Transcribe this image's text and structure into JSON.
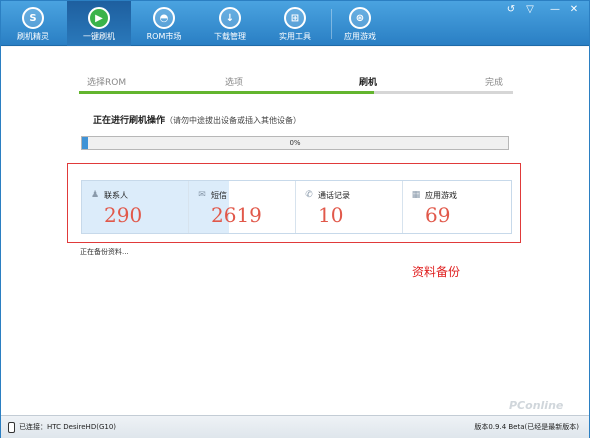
{
  "toolbar": {
    "items": [
      {
        "label": "刷机精灵",
        "icon": "s-logo-icon",
        "glyph": "S"
      },
      {
        "label": "一键刷机",
        "icon": "play-icon",
        "glyph": "▶"
      },
      {
        "label": "ROM市场",
        "icon": "android-icon",
        "glyph": "◓"
      },
      {
        "label": "下载管理",
        "icon": "download-icon",
        "glyph": "↓"
      },
      {
        "label": "实用工具",
        "icon": "tools-grid-icon",
        "glyph": "⊞"
      },
      {
        "label": "应用游戏",
        "icon": "basketball-icon",
        "glyph": "⊛"
      }
    ],
    "active_index": 1,
    "window_controls": {
      "feedback": "↺",
      "menu": "▽",
      "minimize": "—",
      "close": "✕"
    }
  },
  "steps": {
    "items": [
      "选择ROM",
      "选项",
      "刷机",
      "完成"
    ],
    "current_index": 2,
    "progress_fraction": 0.68
  },
  "operation": {
    "title": "正在进行刷机操作",
    "hint": "（请勿中途拔出设备或插入其他设备）"
  },
  "progress": {
    "text": "0%",
    "fraction": 0.015
  },
  "cards": [
    {
      "label": "联系人",
      "count": "290",
      "icon": "contact-icon",
      "glyph": "♟",
      "fill_fraction": 1.0
    },
    {
      "label": "短信",
      "count": "2619",
      "icon": "sms-icon",
      "glyph": "✉",
      "fill_fraction": 0.38
    },
    {
      "label": "通话记录",
      "count": "10",
      "icon": "phone-call-icon",
      "glyph": "✆",
      "fill_fraction": 0.0
    },
    {
      "label": "应用游戏",
      "count": "69",
      "icon": "apps-grid-icon",
      "glyph": "▦",
      "fill_fraction": 0.0
    }
  ],
  "backup_status": "正在备份资料...",
  "annotation": "资料备份",
  "statusbar": {
    "connection": "已连接：HTC DesireHD(G10)",
    "version": "版本0.9.4 Beta(已经是最新版本)"
  },
  "watermark": "PConline",
  "colors": {
    "brand_blue": "#2a7fc4",
    "step_green": "#63b52e",
    "count_red": "#e1584a",
    "annotation_red": "#e02020"
  }
}
